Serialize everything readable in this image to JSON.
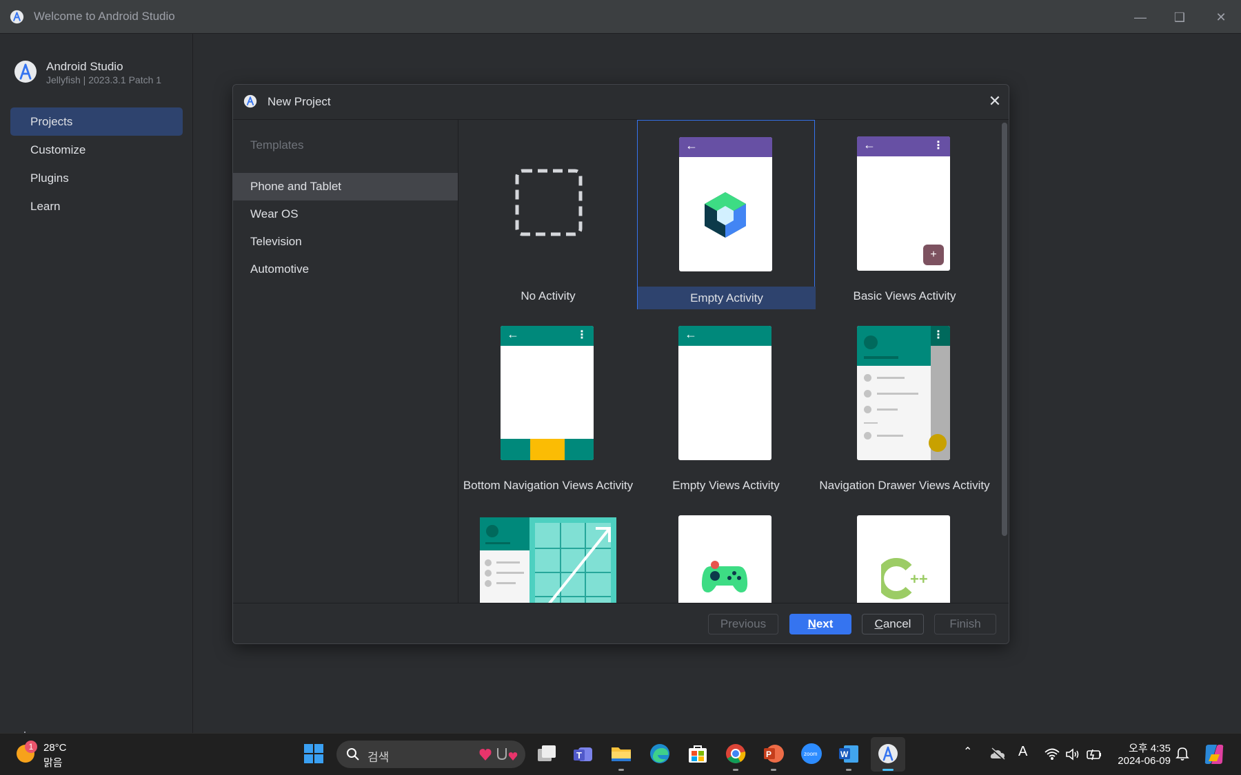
{
  "window": {
    "title": "Welcome to Android Studio"
  },
  "sidebar": {
    "app_name": "Android Studio",
    "version": "Jellyfish | 2023.3.1 Patch 1",
    "items": [
      {
        "label": "Projects",
        "selected": true
      },
      {
        "label": "Customize",
        "selected": false
      },
      {
        "label": "Plugins",
        "selected": false
      },
      {
        "label": "Learn",
        "selected": false
      }
    ]
  },
  "dialog": {
    "title": "New Project",
    "templates_heading": "Templates",
    "categories": [
      {
        "label": "Phone and Tablet",
        "selected": true
      },
      {
        "label": "Wear OS",
        "selected": false
      },
      {
        "label": "Television",
        "selected": false
      },
      {
        "label": "Automotive",
        "selected": false
      }
    ],
    "templates": [
      {
        "label": "No Activity",
        "icon": "dashed-square-icon",
        "selected": false
      },
      {
        "label": "Empty Activity",
        "icon": "compose-logo-icon",
        "selected": true
      },
      {
        "label": "Basic Views Activity",
        "icon": "basic-views-preview-icon",
        "selected": false
      },
      {
        "label": "Bottom Navigation Views Activity",
        "icon": "bottom-nav-preview-icon",
        "selected": false
      },
      {
        "label": "Empty Views Activity",
        "icon": "empty-views-preview-icon",
        "selected": false
      },
      {
        "label": "Navigation Drawer Views Activity",
        "icon": "nav-drawer-preview-icon",
        "selected": false
      },
      {
        "label": "",
        "icon": "responsive-preview-icon",
        "selected": false
      },
      {
        "label": "",
        "icon": "game-controller-icon",
        "selected": false
      },
      {
        "label": "",
        "icon": "cpp-logo-icon",
        "selected": false
      }
    ],
    "buttons": {
      "previous": "Previous",
      "next_mnemonic": "N",
      "next_rest": "ext",
      "cancel_mnemonic": "C",
      "cancel_rest": "ancel",
      "finish": "Finish"
    }
  },
  "taskbar": {
    "weather": {
      "badge": "1",
      "temp": "28°C",
      "desc": "맑음"
    },
    "search_placeholder": "검색",
    "clock": {
      "time": "오후 4:35",
      "date": "2024-06-09"
    }
  },
  "colors": {
    "accent": "#3574f0",
    "selection": "#2e436e",
    "purple_bar": "#6750a4",
    "teal_bar": "#00897b"
  }
}
